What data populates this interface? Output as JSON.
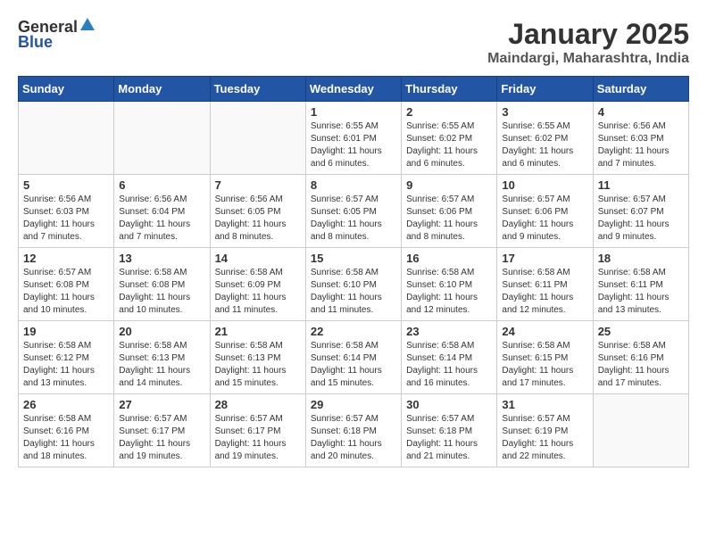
{
  "header": {
    "logo_general": "General",
    "logo_blue": "Blue",
    "title": "January 2025",
    "subtitle": "Maindargi, Maharashtra, India"
  },
  "weekdays": [
    "Sunday",
    "Monday",
    "Tuesday",
    "Wednesday",
    "Thursday",
    "Friday",
    "Saturday"
  ],
  "weeks": [
    [
      {
        "day": "",
        "info": ""
      },
      {
        "day": "",
        "info": ""
      },
      {
        "day": "",
        "info": ""
      },
      {
        "day": "1",
        "info": "Sunrise: 6:55 AM\nSunset: 6:01 PM\nDaylight: 11 hours\nand 6 minutes."
      },
      {
        "day": "2",
        "info": "Sunrise: 6:55 AM\nSunset: 6:02 PM\nDaylight: 11 hours\nand 6 minutes."
      },
      {
        "day": "3",
        "info": "Sunrise: 6:55 AM\nSunset: 6:02 PM\nDaylight: 11 hours\nand 6 minutes."
      },
      {
        "day": "4",
        "info": "Sunrise: 6:56 AM\nSunset: 6:03 PM\nDaylight: 11 hours\nand 7 minutes."
      }
    ],
    [
      {
        "day": "5",
        "info": "Sunrise: 6:56 AM\nSunset: 6:03 PM\nDaylight: 11 hours\nand 7 minutes."
      },
      {
        "day": "6",
        "info": "Sunrise: 6:56 AM\nSunset: 6:04 PM\nDaylight: 11 hours\nand 7 minutes."
      },
      {
        "day": "7",
        "info": "Sunrise: 6:56 AM\nSunset: 6:05 PM\nDaylight: 11 hours\nand 8 minutes."
      },
      {
        "day": "8",
        "info": "Sunrise: 6:57 AM\nSunset: 6:05 PM\nDaylight: 11 hours\nand 8 minutes."
      },
      {
        "day": "9",
        "info": "Sunrise: 6:57 AM\nSunset: 6:06 PM\nDaylight: 11 hours\nand 8 minutes."
      },
      {
        "day": "10",
        "info": "Sunrise: 6:57 AM\nSunset: 6:06 PM\nDaylight: 11 hours\nand 9 minutes."
      },
      {
        "day": "11",
        "info": "Sunrise: 6:57 AM\nSunset: 6:07 PM\nDaylight: 11 hours\nand 9 minutes."
      }
    ],
    [
      {
        "day": "12",
        "info": "Sunrise: 6:57 AM\nSunset: 6:08 PM\nDaylight: 11 hours\nand 10 minutes."
      },
      {
        "day": "13",
        "info": "Sunrise: 6:58 AM\nSunset: 6:08 PM\nDaylight: 11 hours\nand 10 minutes."
      },
      {
        "day": "14",
        "info": "Sunrise: 6:58 AM\nSunset: 6:09 PM\nDaylight: 11 hours\nand 11 minutes."
      },
      {
        "day": "15",
        "info": "Sunrise: 6:58 AM\nSunset: 6:10 PM\nDaylight: 11 hours\nand 11 minutes."
      },
      {
        "day": "16",
        "info": "Sunrise: 6:58 AM\nSunset: 6:10 PM\nDaylight: 11 hours\nand 12 minutes."
      },
      {
        "day": "17",
        "info": "Sunrise: 6:58 AM\nSunset: 6:11 PM\nDaylight: 11 hours\nand 12 minutes."
      },
      {
        "day": "18",
        "info": "Sunrise: 6:58 AM\nSunset: 6:11 PM\nDaylight: 11 hours\nand 13 minutes."
      }
    ],
    [
      {
        "day": "19",
        "info": "Sunrise: 6:58 AM\nSunset: 6:12 PM\nDaylight: 11 hours\nand 13 minutes."
      },
      {
        "day": "20",
        "info": "Sunrise: 6:58 AM\nSunset: 6:13 PM\nDaylight: 11 hours\nand 14 minutes."
      },
      {
        "day": "21",
        "info": "Sunrise: 6:58 AM\nSunset: 6:13 PM\nDaylight: 11 hours\nand 15 minutes."
      },
      {
        "day": "22",
        "info": "Sunrise: 6:58 AM\nSunset: 6:14 PM\nDaylight: 11 hours\nand 15 minutes."
      },
      {
        "day": "23",
        "info": "Sunrise: 6:58 AM\nSunset: 6:14 PM\nDaylight: 11 hours\nand 16 minutes."
      },
      {
        "day": "24",
        "info": "Sunrise: 6:58 AM\nSunset: 6:15 PM\nDaylight: 11 hours\nand 17 minutes."
      },
      {
        "day": "25",
        "info": "Sunrise: 6:58 AM\nSunset: 6:16 PM\nDaylight: 11 hours\nand 17 minutes."
      }
    ],
    [
      {
        "day": "26",
        "info": "Sunrise: 6:58 AM\nSunset: 6:16 PM\nDaylight: 11 hours\nand 18 minutes."
      },
      {
        "day": "27",
        "info": "Sunrise: 6:57 AM\nSunset: 6:17 PM\nDaylight: 11 hours\nand 19 minutes."
      },
      {
        "day": "28",
        "info": "Sunrise: 6:57 AM\nSunset: 6:17 PM\nDaylight: 11 hours\nand 19 minutes."
      },
      {
        "day": "29",
        "info": "Sunrise: 6:57 AM\nSunset: 6:18 PM\nDaylight: 11 hours\nand 20 minutes."
      },
      {
        "day": "30",
        "info": "Sunrise: 6:57 AM\nSunset: 6:18 PM\nDaylight: 11 hours\nand 21 minutes."
      },
      {
        "day": "31",
        "info": "Sunrise: 6:57 AM\nSunset: 6:19 PM\nDaylight: 11 hours\nand 22 minutes."
      },
      {
        "day": "",
        "info": ""
      }
    ]
  ]
}
